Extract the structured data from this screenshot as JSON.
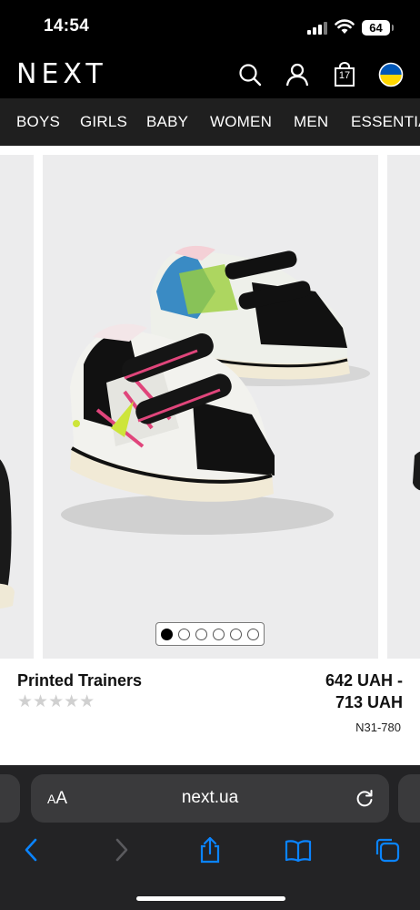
{
  "status_bar": {
    "time": "14:54",
    "battery": "64"
  },
  "header": {
    "logo": "NEXT",
    "bag_count": "17",
    "icons": [
      "search-icon",
      "account-icon",
      "bag-icon",
      "ukraine-flag-icon"
    ]
  },
  "nav": {
    "items": [
      "BOYS",
      "GIRLS",
      "BABY",
      "WOMEN",
      "MEN",
      "ESSENTIALS"
    ]
  },
  "product": {
    "title": "Printed Trainers",
    "price_line1": "642 UAH -",
    "price_line2": "713 UAH",
    "code": "N31-780",
    "rating_stars": "★★★★★",
    "rating": 0,
    "image_count": 6,
    "active_image": 1
  },
  "browser": {
    "text_size_label_small": "A",
    "text_size_label_large": "A",
    "url": "next.ua"
  },
  "colors": {
    "header_bg": "#000000",
    "nav_bg": "#1f1f1f",
    "image_bg": "#ececed",
    "accent_blue": "#0a84ff",
    "flag_blue": "#0057b7",
    "flag_yellow": "#ffd700"
  }
}
